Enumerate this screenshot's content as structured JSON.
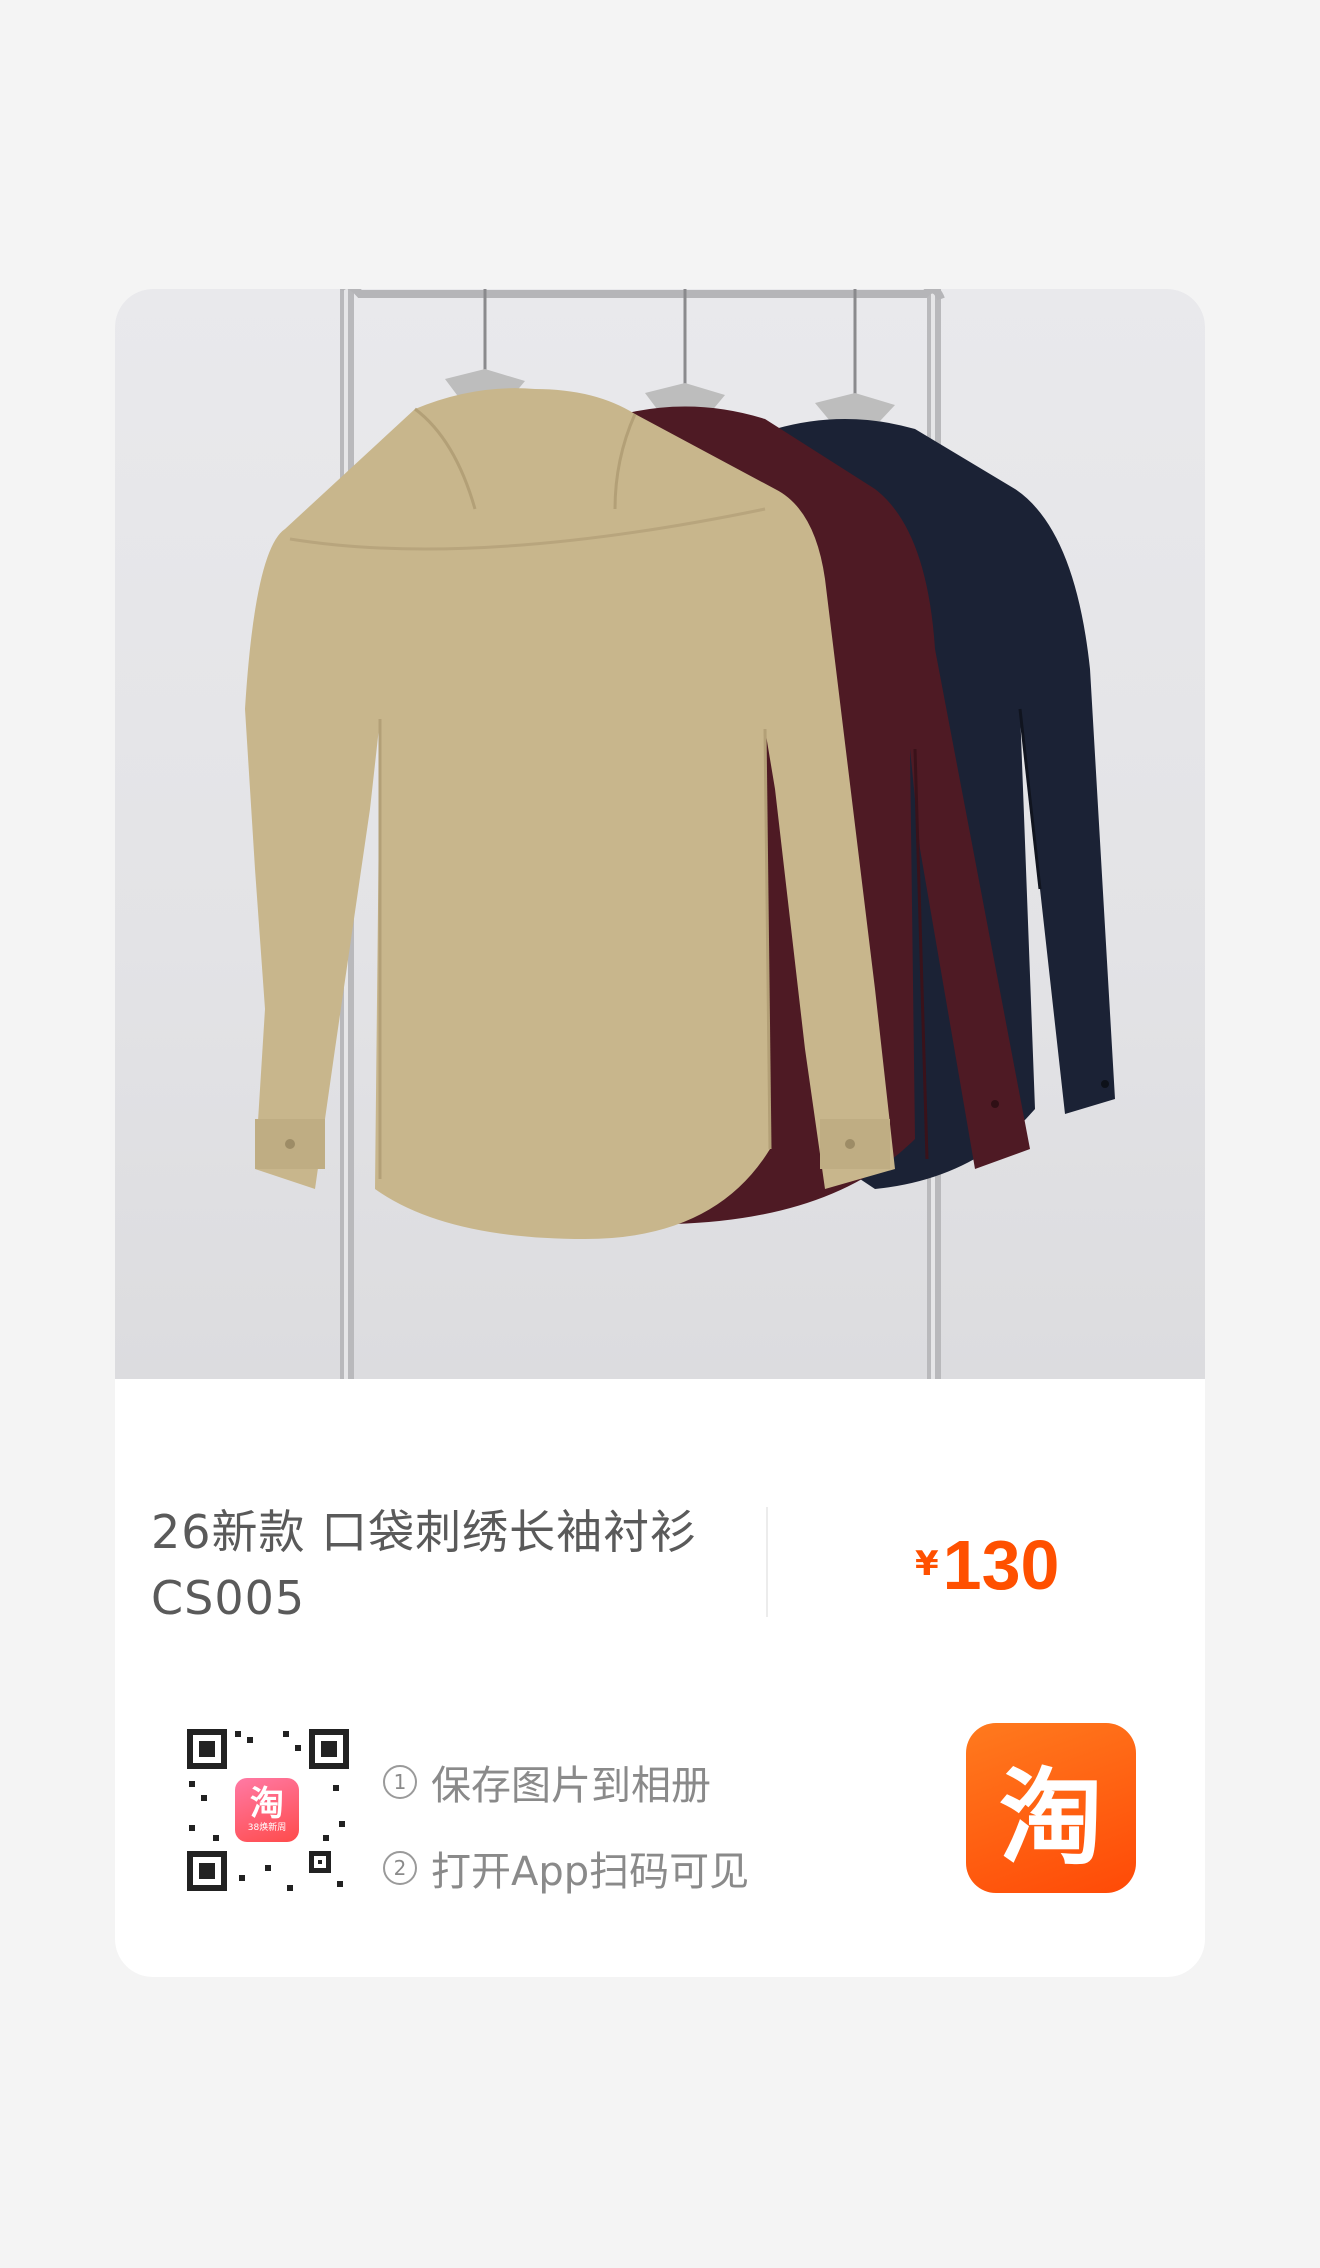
{
  "product": {
    "title_line1": "26新款 口袋刺绣长袖衬衫",
    "title_line2": "CS005",
    "currency": "¥",
    "price": "130"
  },
  "share": {
    "qr_badge_glyph": "淘",
    "qr_badge_caption": "38焕新周",
    "steps": [
      {
        "num": "1",
        "text": "保存图片到相册"
      },
      {
        "num": "2",
        "text": "打开App扫码可见"
      }
    ],
    "app_icon_glyph": "淘"
  },
  "colors": {
    "accent": "#ff5000",
    "shirts": [
      "#c8b68c",
      "#4e1a24",
      "#1b2235"
    ]
  },
  "icons": {
    "app": "taobao-app-icon",
    "qr": "qr-code-icon"
  }
}
